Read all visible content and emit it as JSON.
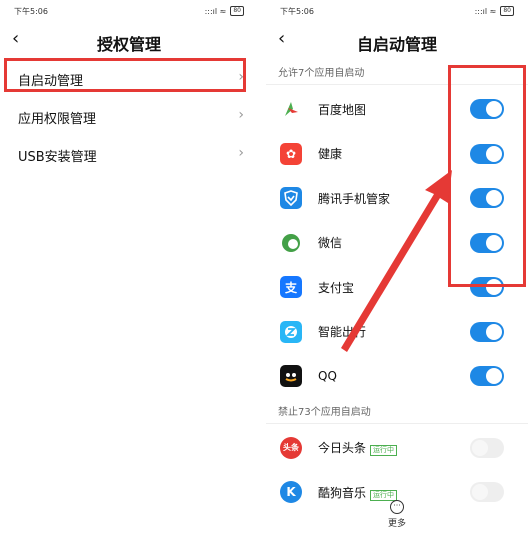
{
  "left": {
    "status_time": "下午5:06",
    "status_icons": ":::ıl ≈",
    "battery": "80",
    "back": "‹",
    "title": "授权管理",
    "items": [
      {
        "label": "自启动管理"
      },
      {
        "label": "应用权限管理"
      },
      {
        "label": "USB安装管理"
      }
    ]
  },
  "right": {
    "status_time": "下午5:06",
    "status_icons": ":::ıl ≈",
    "battery": "80",
    "back": "‹",
    "title": "自启动管理",
    "allowed_header": "允许7个应用自启动",
    "forbidden_header": "禁止73个应用自启动",
    "allowed_apps": [
      {
        "name": "百度地图",
        "icon": "map-pin-icon",
        "color": "#ffffff",
        "on": true
      },
      {
        "name": "健康",
        "icon": "health-icon",
        "color": "#f44336",
        "on": true
      },
      {
        "name": "腾讯手机管家",
        "icon": "shield-icon",
        "color": "#1e88e5",
        "on": true
      },
      {
        "name": "微信",
        "icon": "wechat-icon",
        "color": "#43a047",
        "on": true
      },
      {
        "name": "支付宝",
        "icon": "alipay-icon",
        "color": "#1677ff",
        "on": true
      },
      {
        "name": "智能出行",
        "icon": "travel-icon",
        "color": "#29b6f6",
        "on": true
      },
      {
        "name": "QQ",
        "icon": "qq-icon",
        "color": "#111111",
        "on": true
      }
    ],
    "forbidden_apps": [
      {
        "name": "今日头条",
        "running": "运行中",
        "icon": "toutiao-icon",
        "color": "#e53935",
        "on": false
      },
      {
        "name": "酷狗音乐",
        "running": "运行中",
        "icon": "kugou-icon",
        "color": "#1e88e5",
        "on": false
      }
    ],
    "more": "更多",
    "toggle_on_color": "#1e88e5",
    "highlight_color": "#e53935"
  }
}
